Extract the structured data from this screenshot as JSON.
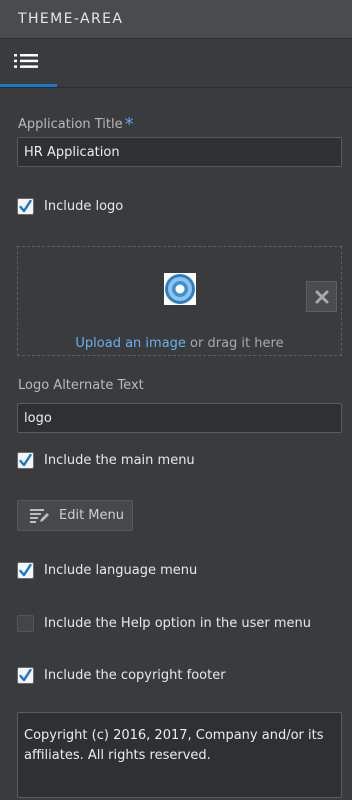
{
  "panel": {
    "title": "THEME-AREA"
  },
  "tabs": [
    {
      "icon": "list-icon",
      "active": true
    }
  ],
  "accent_color": "#1e76c6",
  "link_color": "#6ab0ee",
  "app_title": {
    "label": "Application Title",
    "required_marker": "*",
    "value": "HR Application"
  },
  "include_logo": {
    "label": "Include logo",
    "checked": true
  },
  "logo_upload": {
    "link_text": "Upload an image",
    "suffix_text": " or drag it here",
    "remove_icon": "close-icon",
    "preview_icon": "logo-image"
  },
  "logo_alt": {
    "label": "Logo Alternate Text",
    "value": "logo"
  },
  "include_main_menu": {
    "label": "Include the main menu",
    "checked": true
  },
  "edit_menu_button": {
    "label": "Edit Menu",
    "icon": "edit-list-icon"
  },
  "include_language_menu": {
    "label": "Include language menu",
    "checked": true
  },
  "include_help": {
    "label": "Include the Help option in the user menu",
    "checked": false
  },
  "include_copyright": {
    "label": "Include the copyright footer",
    "checked": true
  },
  "copyright_text": "Copyright (c) 2016, 2017, Company and/or its affiliates. All rights reserved."
}
